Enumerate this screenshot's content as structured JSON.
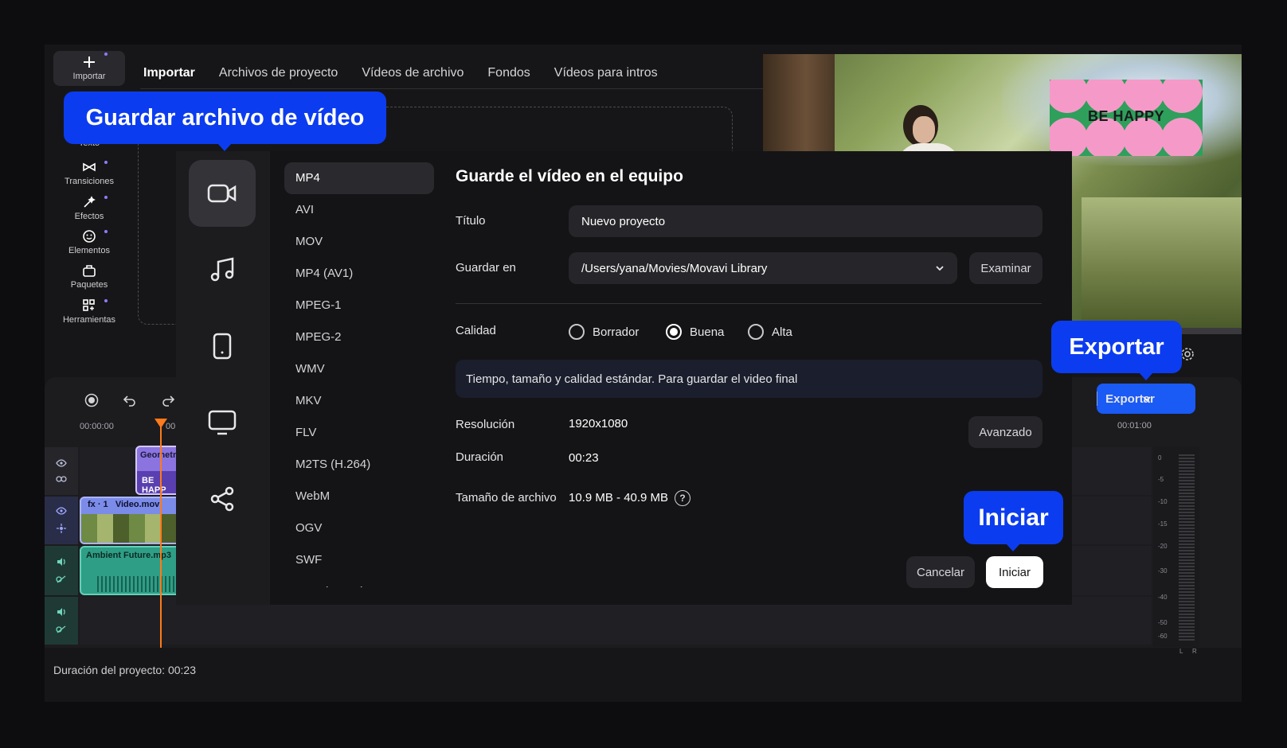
{
  "sidebar": {
    "items": [
      {
        "label": "Importar",
        "icon": "plus-icon"
      },
      {
        "label": "Texto",
        "icon": "text-icon"
      },
      {
        "label": "Transiciones",
        "icon": "transitions-icon"
      },
      {
        "label": "Efectos",
        "icon": "effects-icon"
      },
      {
        "label": "Elementos",
        "icon": "smiley-icon"
      },
      {
        "label": "Paquetes",
        "icon": "packages-icon"
      },
      {
        "label": "Herramientas",
        "icon": "tools-grid-icon"
      }
    ]
  },
  "tabs": [
    "Importar",
    "Archivos de proyecto",
    "Vídeos de archivo",
    "Fondos",
    "Vídeos para intros"
  ],
  "preview": {
    "sticker_text": "BE HAPPY"
  },
  "timeline": {
    "time_start": "00:00:00",
    "time_partial": "00",
    "time_end": "00:01:00",
    "clips": {
      "title_l1": "Geometr",
      "title_l2": "BE HAPP",
      "video_fx": "fx · 1",
      "video_name": "Video.mov",
      "audio_name": "Ambient Future.mp3"
    },
    "vu_levels": [
      "0",
      "-5",
      "-10",
      "-15",
      "-20",
      "-30",
      "-40",
      "-50",
      "-60"
    ],
    "lr": [
      "L",
      "R"
    ],
    "export_label": "Exportar"
  },
  "status": {
    "duration": "Duración del proyecto: 00:23"
  },
  "dialog": {
    "formats": [
      "MP4",
      "AVI",
      "MOV",
      "MP4 (AV1)",
      "MPEG-1",
      "MPEG-2",
      "WMV",
      "MKV",
      "FLV",
      "M2TS (H.264)",
      "WebM",
      "OGV",
      "SWF",
      "DVD (NTSC)"
    ],
    "heading": "Guarde el vídeo en el equipo",
    "title_label": "Título",
    "title_value": "Nuevo proyecto",
    "save_label": "Guardar en",
    "save_path": "/Users/yana/Movies/Movavi Library",
    "browse": "Examinar",
    "quality_label": "Calidad",
    "quality_options": [
      "Borrador",
      "Buena",
      "Alta"
    ],
    "quality_selected": "Buena",
    "quality_info": "Tiempo, tamaño y calidad estándar. Para guardar el video final",
    "resolution_label": "Resolución",
    "resolution_value": "1920x1080",
    "advanced": "Avanzado",
    "duration_label": "Duración",
    "duration_value": "00:23",
    "filesize_label": "Tamaño de archivo",
    "filesize_value": "10.9 MB - 40.9 MB",
    "help_glyph": "?",
    "cancel": "Cancelar",
    "start": "Iniciar"
  },
  "callouts": {
    "save_file": "Guardar archivo de vídeo",
    "export": "Exportar",
    "start": "Iniciar"
  },
  "colors": {
    "accent": "#1a5af5",
    "callout": "#0c3cf0",
    "playhead": "#ff7a1a"
  }
}
